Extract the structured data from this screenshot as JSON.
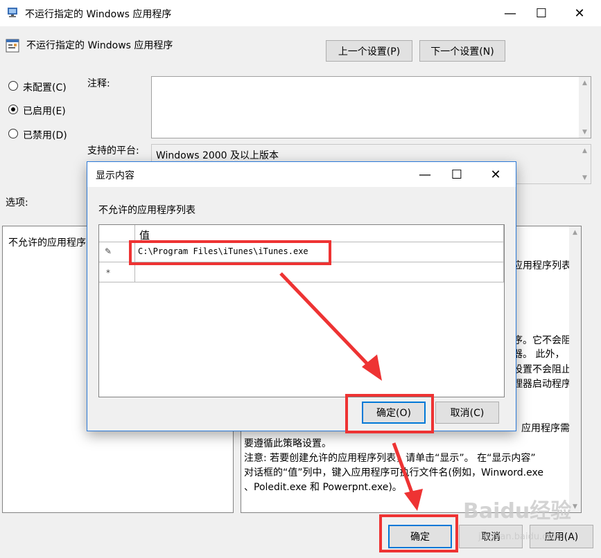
{
  "window": {
    "title": "不运行指定的 Windows 应用程序",
    "min": "—",
    "max": "☐",
    "close": "✕"
  },
  "policy": {
    "name": "不运行指定的 Windows 应用程序",
    "prev_button": "上一个设置(P)",
    "next_button": "下一个设置(N)"
  },
  "radios": [
    {
      "label": "未配置(C)",
      "checked": false
    },
    {
      "label": "已启用(E)",
      "checked": true
    },
    {
      "label": "已禁用(D)",
      "checked": false
    }
  ],
  "comment_label": "注释:",
  "platform_label": "支持的平台:",
  "platform_value": "Windows 2000 及以上版本",
  "options_label": "选项:",
  "options_pane": {
    "item": "不允许的应用程序"
  },
  "help_pane": {
    "lines": [
      "应用程序列表中",
      "序。它不会阻",
      "器。 此外，",
      "设置不会阻止",
      "理器启动程序",
      "应用程序需",
      "要遵循此策略设置。",
      "注意: 若要创建允许的应用程序列表，请单击“显示”。 在“显示内容”",
      "对话框的“值”列中，键入应用程序可执行文件名(例如，Winword.exe",
      "、Poledit.exe 和 Powerpnt.exe)。"
    ]
  },
  "footer": {
    "ok": "确定",
    "cancel": "取消",
    "apply": "应用(A)"
  },
  "dialog": {
    "title": "显示内容",
    "min": "—",
    "max": "☐",
    "close": "✕",
    "list_label": "不允许的应用程序列表",
    "column_header": "值",
    "rows": [
      {
        "marker": "✎",
        "value": "C:\\Program Files\\iTunes\\iTunes.exe"
      },
      {
        "marker": "*",
        "value": ""
      }
    ],
    "ok": "确定(O)",
    "cancel": "取消(C)"
  },
  "watermark": {
    "logo": "Baidu经验",
    "url": "jingyan.baidu.com"
  },
  "colors": {
    "annotation": "#ee3333",
    "dialog_border": "#2b79d8"
  }
}
